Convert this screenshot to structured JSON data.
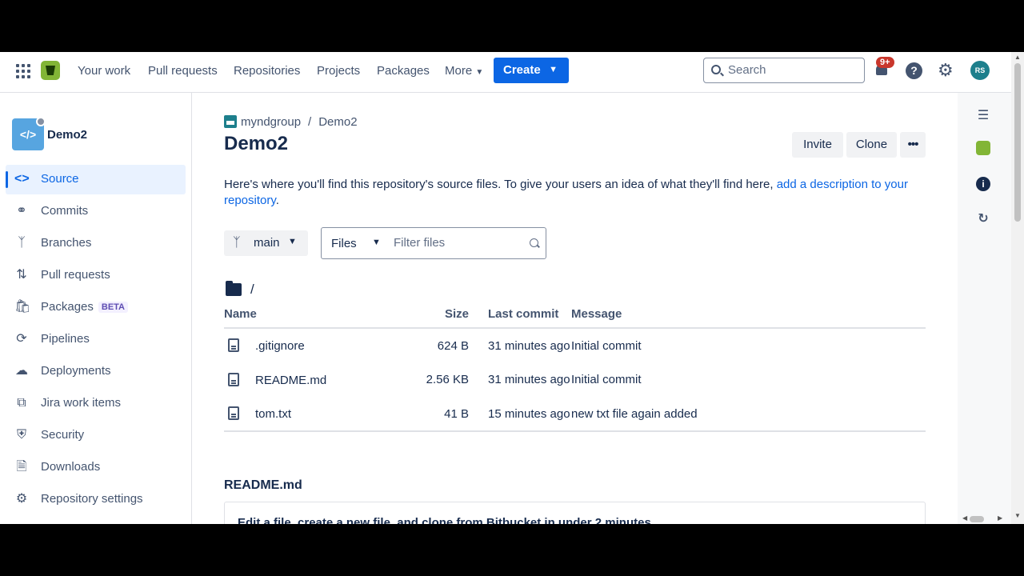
{
  "nav": {
    "items": [
      "Your work",
      "Pull requests",
      "Repositories",
      "Projects",
      "Packages",
      "More"
    ],
    "create_label": "Create",
    "search_placeholder": "Search",
    "notification_badge": "9+",
    "avatar_initials": "RS"
  },
  "sidebar": {
    "repo_name": "Demo2",
    "items": [
      {
        "label": "Source"
      },
      {
        "label": "Commits"
      },
      {
        "label": "Branches"
      },
      {
        "label": "Pull requests"
      },
      {
        "label": "Packages",
        "badge": "BETA"
      },
      {
        "label": "Pipelines"
      },
      {
        "label": "Deployments"
      },
      {
        "label": "Jira work items"
      },
      {
        "label": "Security"
      },
      {
        "label": "Downloads"
      },
      {
        "label": "Repository settings"
      }
    ]
  },
  "main": {
    "breadcrumb_workspace": "myndgroup",
    "breadcrumb_sep": "/",
    "breadcrumb_repo": "Demo2",
    "title": "Demo2",
    "invite_label": "Invite",
    "clone_label": "Clone",
    "more_label": "•••",
    "description_text": "Here's where you'll find this repository's source files. To give your users an idea of what they'll find here, ",
    "description_link": "add a description to your repository",
    "description_end": ".",
    "branch": "main",
    "filter_type": "Files",
    "filter_placeholder": "Filter files",
    "path": "/",
    "columns": {
      "name": "Name",
      "size": "Size",
      "last_commit": "Last commit",
      "message": "Message"
    },
    "files": [
      {
        "name": ".gitignore",
        "size": "624 B",
        "last_commit": "31 minutes ago",
        "message": "Initial commit"
      },
      {
        "name": "README.md",
        "size": "2.56 KB",
        "last_commit": "31 minutes ago",
        "message": "Initial commit"
      },
      {
        "name": "tom.txt",
        "size": "41 B",
        "last_commit": "15 minutes ago",
        "message": "new txt file again added"
      }
    ],
    "readme_title": "README.md",
    "readme_heading": "Edit a file, create a new file, and clone from Bitbucket in under 2 minutes"
  },
  "colors": {
    "accent": "#0c66e4",
    "logo": "#82b536",
    "badge": "#c9372c"
  }
}
